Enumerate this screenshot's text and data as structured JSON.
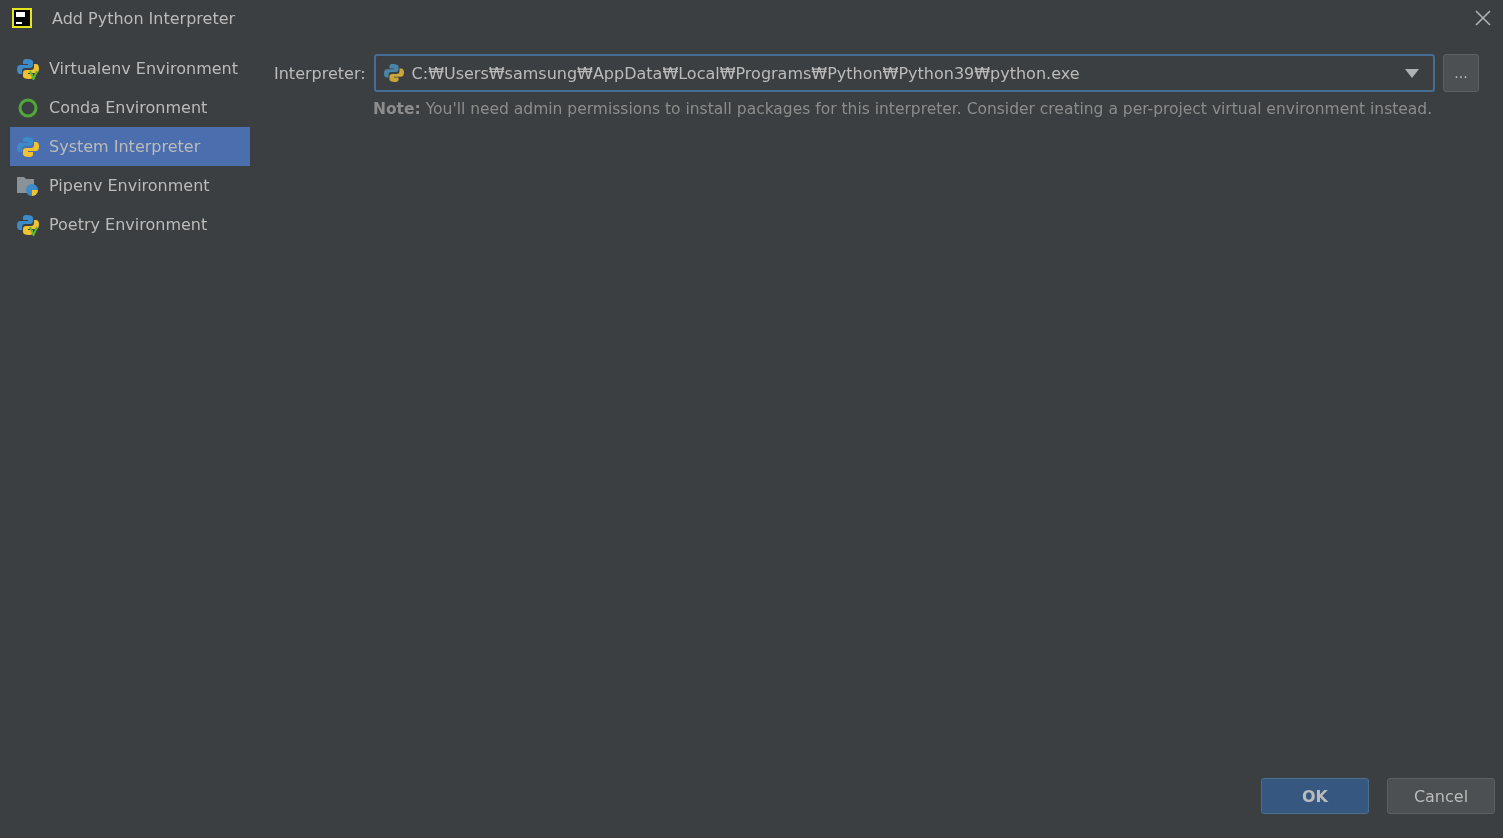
{
  "window": {
    "title": "Add Python Interpreter"
  },
  "sidebar": {
    "items": [
      {
        "label": "Virtualenv Environment",
        "kind": "virtualenv",
        "selected": false
      },
      {
        "label": "Conda Environment",
        "kind": "conda",
        "selected": false
      },
      {
        "label": "System Interpreter",
        "kind": "python",
        "selected": true
      },
      {
        "label": "Pipenv Environment",
        "kind": "pipenv",
        "selected": false
      },
      {
        "label": "Poetry Environment",
        "kind": "virtualenv",
        "selected": false
      }
    ]
  },
  "interpreter": {
    "label": "Interpreter:",
    "value": "C:₩Users₩samsung₩AppData₩Local₩Programs₩Python₩Python39₩python.exe",
    "browse": "...",
    "note": "**Note:** You'll need admin permissions to install packages for this interpreter. Consider creating a per-project virtual environment instead."
  },
  "buttons": [
    {
      "label": "OK",
      "kind": "default"
    },
    {
      "label": "Cancel",
      "kind": "normal"
    }
  ]
}
